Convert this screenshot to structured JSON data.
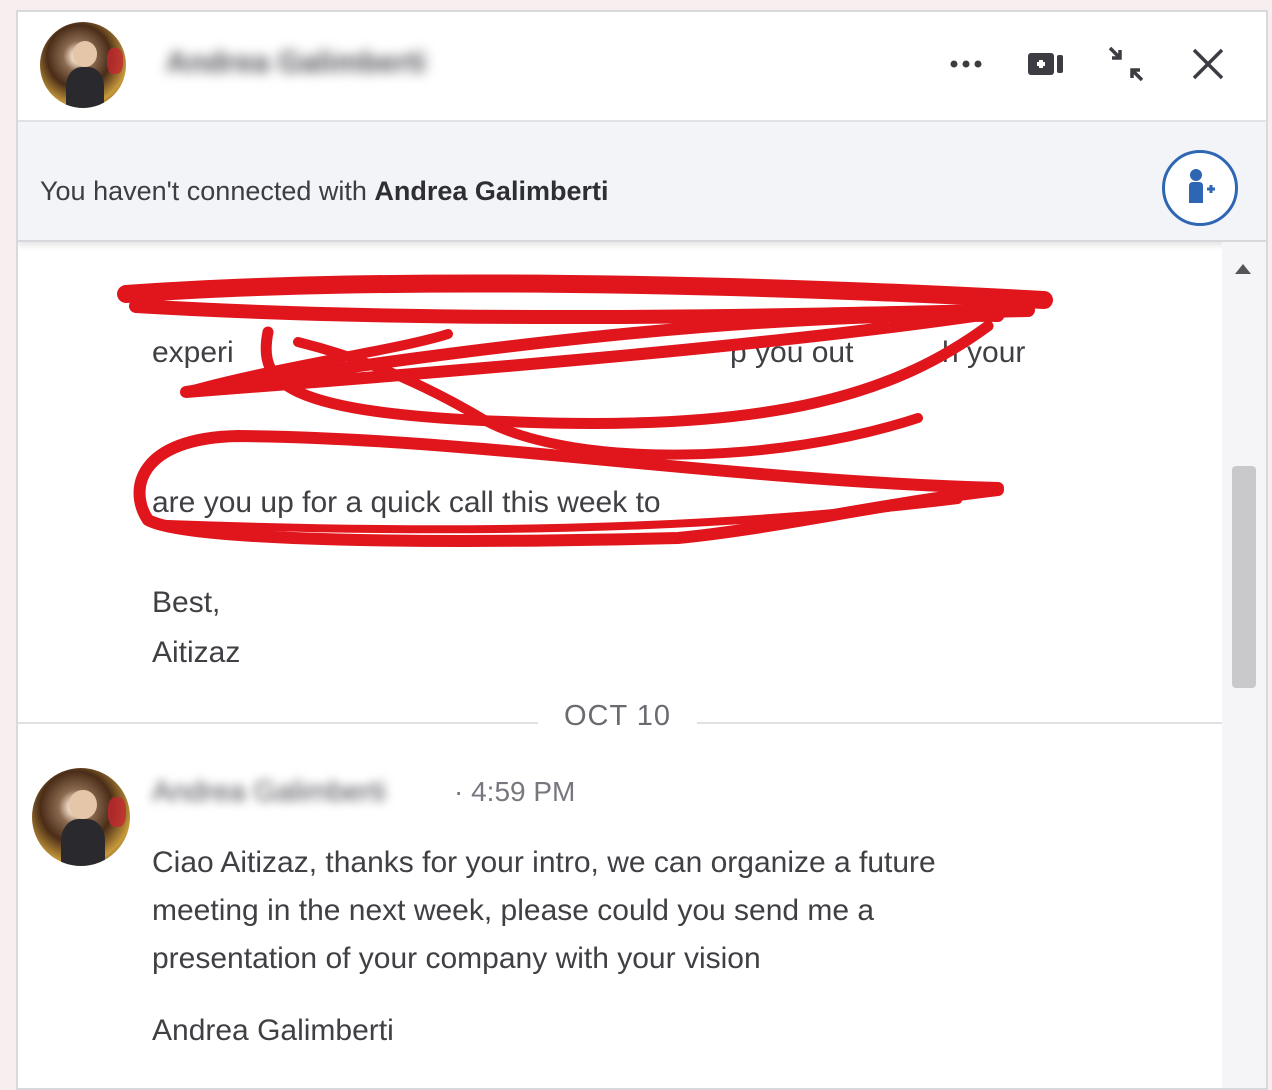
{
  "header": {
    "contact_name": "Andrea Galimberti",
    "more_icon": "more-icon",
    "video_icon": "video-call-icon",
    "minimize_icon": "minimize-icon",
    "close_icon": "close-icon"
  },
  "banner": {
    "prefix": "You haven't connected with ",
    "contact_name": "Andrea Galimberti",
    "connect_icon": "add-connection-icon"
  },
  "previous_message": {
    "lines": [
      "experi",
      "p you out",
      "h your",
      "are you up for a quick call this week to"
    ],
    "signoff": "Best,",
    "signature": "Aitizaz"
  },
  "date_divider": "OCT 10",
  "reply": {
    "sender": "Andrea Galimberti",
    "time": "· 4:59 PM",
    "lines": [
      "Ciao Aitizaz, thanks for your intro, we can organize a future",
      "meeting in the next week, please could you send me a",
      "presentation of your company with your vision"
    ],
    "signature": "Andrea Galimberti"
  },
  "colors": {
    "accent": "#2f66b3",
    "redaction": "#e0161c"
  }
}
